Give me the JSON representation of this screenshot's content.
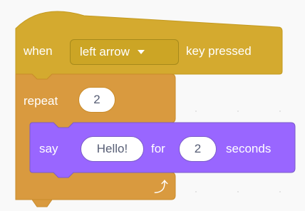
{
  "hat_block": {
    "when_label": "when",
    "key_option": "left arrow",
    "suffix_label": "key pressed"
  },
  "repeat_block": {
    "label": "repeat",
    "count": "2",
    "loop_icon": "loop-arrow-icon"
  },
  "say_block": {
    "label": "say",
    "message": "Hello!",
    "for_label": "for",
    "seconds_value": "2",
    "seconds_label": "seconds"
  },
  "colors": {
    "events_fill": "#ffbf00",
    "events_dark": "#d4aa2f",
    "control_fill": "#e1a94d",
    "looks_fill": "#9966ff",
    "canvas_background": "#f9f9f9"
  }
}
